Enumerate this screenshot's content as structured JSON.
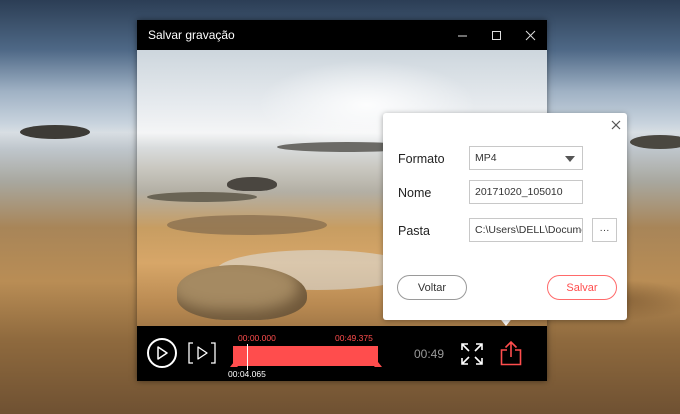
{
  "window": {
    "title": "Salvar gravação",
    "minimize_icon": "minimize-icon",
    "maximize_icon": "maximize-icon",
    "close_icon": "close-icon"
  },
  "player": {
    "trim_start": "00:00.000",
    "trim_end": "00:49.375",
    "cursor_time": "00:04.065",
    "duration": "00:49",
    "accent_color": "#ff4d4d"
  },
  "dialog": {
    "format_label": "Formato",
    "format_value": "MP4",
    "name_label": "Nome",
    "name_value": "20171020_105010",
    "folder_label": "Pasta",
    "folder_value": "C:\\Users\\DELL\\Docume",
    "browse_label": "···",
    "back_button": "Voltar",
    "save_button": "Salvar"
  }
}
